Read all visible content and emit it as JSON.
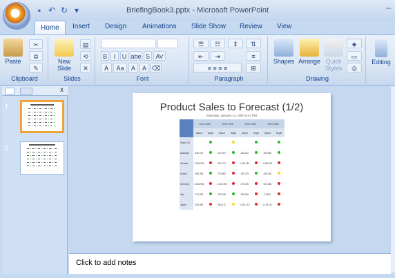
{
  "window": {
    "title": "BriefingBook3.pptx - Microsoft PowerPoint"
  },
  "tabs": [
    "Home",
    "Insert",
    "Design",
    "Animations",
    "Slide Show",
    "Review",
    "View"
  ],
  "ribbon": {
    "groups": [
      "Clipboard",
      "Slides",
      "Font",
      "Paragraph",
      "Drawing"
    ],
    "paste_label": "Paste",
    "new_slide_label": "New Slide",
    "shapes_label": "Shapes",
    "arrange_label": "Arrange",
    "quick_styles_label": "Quick Styles",
    "editing_label": "Editing",
    "font_buttons": [
      "B",
      "I",
      "U",
      "abe",
      "S",
      "AV",
      "A",
      "Aa",
      "A",
      "A"
    ]
  },
  "slides_pane": {
    "numbers": [
      "1",
      "2"
    ]
  },
  "slide": {
    "title": "Product Sales to Forecast (1/2)",
    "subtitle": "Saturday, January 13, 2007 6:47 PM",
    "periods": [
      "02/07 2006",
      "02/07 2006",
      "03/07 2006",
      "04/07 2006"
    ],
    "col_headers": [
      "Actual",
      "Target",
      "Actual",
      "Target",
      "Actual",
      "Target",
      "Actual",
      "Target"
    ],
    "rows": [
      {
        "label": "Sales Ctrl",
        "cells": [
          "",
          "g",
          "",
          "y",
          "",
          "g",
          "",
          "g"
        ]
      },
      {
        "label": "Australia",
        "cells": [
          "832,375",
          "g",
          "187,537",
          "g",
          "246,212",
          "g",
          "309,860",
          "g"
        ]
      },
      {
        "label": "Canada",
        "cells": [
          "1,290,325",
          "r",
          "957,377",
          "r",
          "1,332,861",
          "r",
          "1,452,331",
          "r"
        ]
      },
      {
        "label": "France",
        "cells": [
          "388,256",
          "g",
          "275,952",
          "r",
          "180,275",
          "g",
          "430,226",
          "y"
        ]
      },
      {
        "label": "Germany",
        "cells": [
          "1,032,905",
          "r",
          "1,129,785",
          "r",
          "275,736",
          "r",
          "931,286",
          "r"
        ]
      },
      {
        "label": "Italy",
        "cells": [
          "310,338",
          "g",
          "333,246",
          "g",
          "335,246",
          "r",
          "74,831",
          "r"
        ]
      },
      {
        "label": "Japan",
        "cells": [
          "438,296",
          "r",
          "803,111",
          "y",
          "1,631,373",
          "r",
          "1,119,371",
          "r"
        ]
      }
    ],
    "colors": {
      "g": "#23b823",
      "r": "#e0232f",
      "y": "#f2dc1d"
    }
  },
  "notes": {
    "placeholder": "Click to add notes"
  }
}
